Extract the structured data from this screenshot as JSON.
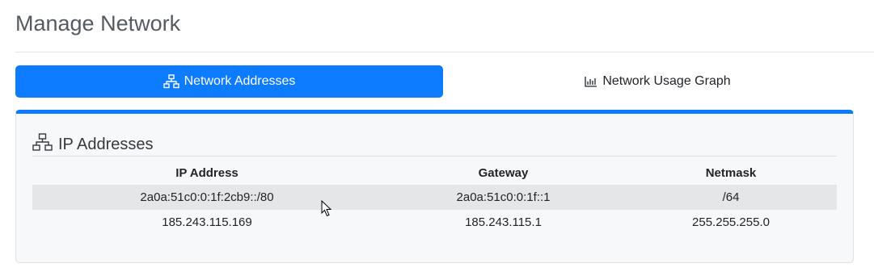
{
  "page": {
    "title": "Manage Network"
  },
  "tabs": [
    {
      "label": "Network Addresses",
      "icon": "network-icon",
      "active": true
    },
    {
      "label": "Network Usage Graph",
      "icon": "bar-chart-icon",
      "active": false
    }
  ],
  "card": {
    "title": "IP Addresses",
    "icon": "network-icon",
    "accent_color": "#0d7bfd"
  },
  "table": {
    "headers": [
      "IP Address",
      "Gateway",
      "Netmask"
    ],
    "rows": [
      [
        "2a0a:51c0:0:1f:2cb9::/80",
        "2a0a:51c0:0:1f::1",
        "/64"
      ],
      [
        "185.243.115.169",
        "185.243.115.1",
        "255.255.255.0"
      ]
    ]
  },
  "colors": {
    "primary": "#0d7bfd",
    "row_highlight": "#e5e6e7"
  }
}
